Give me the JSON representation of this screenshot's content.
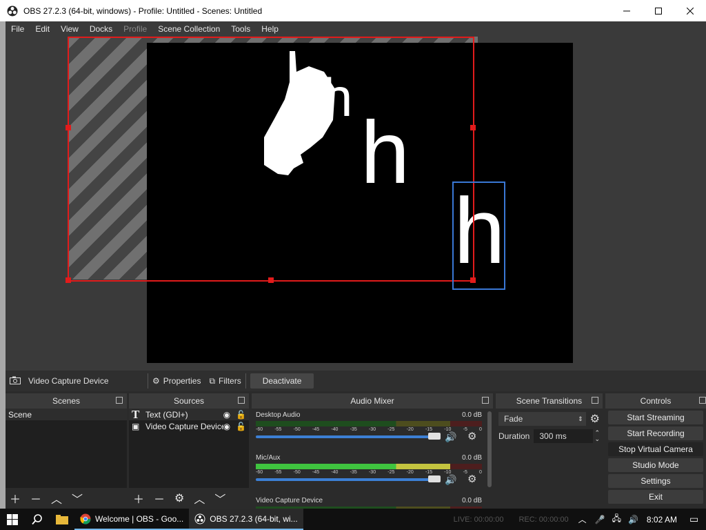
{
  "window": {
    "title": "OBS 27.2.3 (64-bit, windows) - Profile: Untitled - Scenes: Untitled"
  },
  "menu": [
    "File",
    "Edit",
    "View",
    "Docks",
    "Profile",
    "Scene Collection",
    "Tools",
    "Help"
  ],
  "preview": {
    "letter": "h"
  },
  "source_bar": {
    "selected_source": "Video Capture Device",
    "properties": "Properties",
    "filters": "Filters",
    "deactivate": "Deactivate"
  },
  "scenes": {
    "title": "Scenes",
    "items": [
      "Scene"
    ]
  },
  "sources": {
    "title": "Sources",
    "items": [
      "Text (GDI+)",
      "Video Capture Device"
    ]
  },
  "mixer": {
    "title": "Audio Mixer",
    "tracks": [
      {
        "name": "Desktop Audio",
        "level": "0.0 dB"
      },
      {
        "name": "Mic/Aux",
        "level": "0.0 dB"
      },
      {
        "name": "Video Capture Device",
        "level": "0.0 dB"
      }
    ],
    "ticks": [
      "-60",
      "-55",
      "-50",
      "-45",
      "-40",
      "-35",
      "-30",
      "-25",
      "-20",
      "-15",
      "-10",
      "-5",
      "0"
    ]
  },
  "transitions": {
    "title": "Scene Transitions",
    "selected": "Fade",
    "duration_label": "Duration",
    "duration_value": "300 ms"
  },
  "controls": {
    "title": "Controls",
    "buttons": [
      "Start Streaming",
      "Start Recording",
      "Stop Virtual Camera",
      "Studio Mode",
      "Settings",
      "Exit"
    ]
  },
  "status": {
    "live": "LIVE: 00:00:00",
    "rec": "REC: 00:00:00"
  },
  "taskbar": {
    "chrome": "Welcome | OBS - Goo...",
    "obs": "OBS 27.2.3 (64-bit, wi...",
    "time": "8:02 AM"
  }
}
